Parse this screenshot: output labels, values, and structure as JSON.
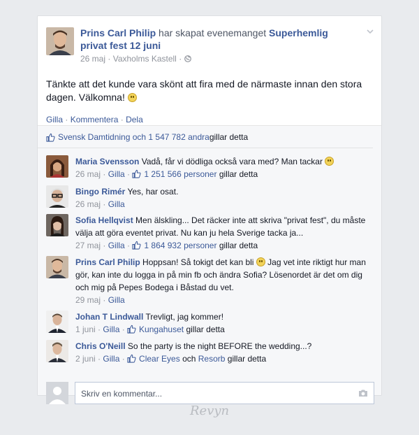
{
  "post": {
    "author": "Prins Carl Philip",
    "action": " har skapat evenemanget ",
    "event": "Superhemlig privat fest 12 juni",
    "date": "26 maj",
    "location": "Vaxholms Kastell",
    "text": "Tänkte att det kunde vara skönt att fira med de närmaste innan den stora dagen. Välkomna!",
    "actions": {
      "like": "Gilla",
      "comment": "Kommentera",
      "share": "Dela",
      "sep": " · "
    }
  },
  "likes": {
    "names": "Svensk Damtidning och 1 547 782 andra",
    "suffix": " gillar detta"
  },
  "comments": [
    {
      "name": "Maria Svensson",
      "text": " Vadå, får vi dödliga också vara med? Man tackar",
      "date": "26 maj",
      "like": "Gilla",
      "likes_link": "1 251 566 personer",
      "likes_suffix": " gillar detta"
    },
    {
      "name": "Bingo Rimér",
      "text": " Yes, har osat.",
      "date": "26 maj",
      "like": "Gilla"
    },
    {
      "name": "Sofia Hellqvist",
      "text": " Men älskling... Det räcker inte att skriva \"privat fest\", du måste välja att göra eventet privat. Nu kan ju hela Sverige tacka ja...",
      "date": "27 maj",
      "like": "Gilla",
      "likes_link": "1 864 932 personer",
      "likes_suffix": " gillar detta"
    },
    {
      "name": "Prins Carl Philip",
      "text": " Hoppsan! Så tokigt det kan bli",
      "text2": " Jag vet inte riktigt hur man gör, kan inte du logga in på min fb och ändra Sofia? Lösenordet är det om dig och mig på Pepes Bodega i Båstad du vet.",
      "date": "29 maj",
      "like": "Gilla"
    },
    {
      "name": "Johan T Lindwall",
      "text": " Trevligt, jag kommer!",
      "date": "1 juni",
      "like": "Gilla",
      "likes_link": "Kungahuset",
      "likes_suffix": " gillar detta"
    },
    {
      "name": "Chris O'Neill",
      "text": " So the party is the night BEFORE the wedding...?",
      "date": "2 juni",
      "like": "Gilla",
      "likes_link": "Clear Eyes",
      "likes_and": " och ",
      "likes_link2": "Resorb",
      "likes_suffix": " gillar detta"
    }
  ],
  "composer": {
    "placeholder": "Skriv en kommentar..."
  },
  "watermark": "Revyn",
  "colors": {
    "link": "#3b5998",
    "bg": "#e9ebee",
    "ufi": "#f6f7f9"
  },
  "icons": [
    "chevron-down-icon",
    "globe-icon",
    "like-thumb-icon",
    "smiley-icon",
    "camera-icon"
  ]
}
